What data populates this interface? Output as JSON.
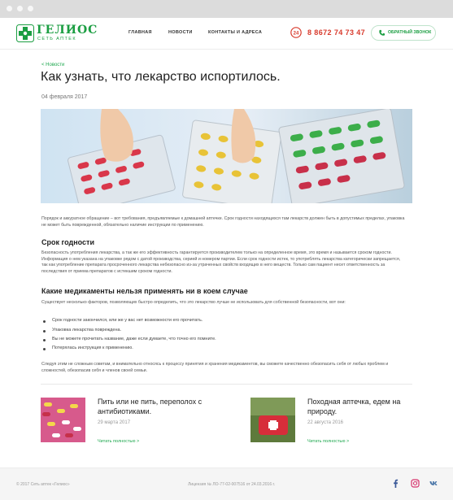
{
  "header": {
    "logo_name": "ГЕЛИОС",
    "logo_sub": "СЕТЬ АПТЕК",
    "nav": [
      "ГЛАВНАЯ",
      "НОВОСТИ",
      "КОНТАКТЫ И АДРЕСА"
    ],
    "phone_badge": "24",
    "phone": "8 8672 74 73 47",
    "callback_label": "ОБРАТНЫЙ ЗВОНОК"
  },
  "article": {
    "breadcrumb": "< Новости",
    "title": "Как узнать, что лекарство испортилось.",
    "date": "04 февраля 2017",
    "intro": "Порядок и аккуратное обращение – вот требования, предъявляемые к домашней аптечке. Срок годности находящихся там лекарств должен быть в допустимых пределах, упаковка не может быть поврежденной, обязательно наличие инструкции по применению.",
    "h_expiry": "Срок годности",
    "p_expiry": "Безопасность употребления лекарства, а так же его эффективность гарантируется производителем только на определенное время, это время и называется сроком годности. Информация о нем указана на упаковке рядом с датой производства, серией и номером партии. Если срок годности истек, то употреблять лекарства категорически запрещается, так как употребление препарата просроченного лекарства небезопасно из-за утраченных свойств входящих в него веществ. Только сам пациент несет ответственность за последствия от приема препаратов с истекшим сроком годности.",
    "h_forbidden": "Какие медикаменты нельзя применять ни в коем случае",
    "p_factors": "Существует несколько факторов, позволяющих быстро определить, что это лекарство лучше не использовать для собственной безопасности, вот они:",
    "list": [
      "Срок годности закончился, или же у вас нет возможности его прочитать.",
      "Упаковка лекарства повреждена.",
      "Вы не можете прочитать название, даже если думаете, что точно его помните.",
      "Потерялась инструкция к применению."
    ],
    "outro": "Следуя этим не сложным советам, и внимательно относясь к процессу принятия и хранения медикаментов, вы сможете качественно обезопасить себя от любых проблем и сложностей, обезопасив себя и членов своей семьи."
  },
  "related": [
    {
      "title": "Пить или не пить, переполох с антибиотиками.",
      "date": "29 марта 2017",
      "more": "Читать полностью >"
    },
    {
      "title": "Походная аптечка, едем на природу.",
      "date": "22 августа 2016",
      "more": "Читать полностью >"
    }
  ],
  "footer": {
    "copyright": "© 2017 Сеть аптек «Гелиос»",
    "license": "Лицензия № ЛО-77-02-007516 от 24.03.2016 г.",
    "socials": [
      "facebook-icon",
      "instagram-icon",
      "vk-icon"
    ]
  },
  "colors": {
    "brand_green": "#1b9e42",
    "phone_red": "#d83a2c",
    "link_green": "#1fa84f"
  }
}
